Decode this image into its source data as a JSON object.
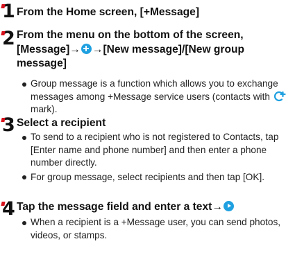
{
  "steps": [
    {
      "number": "1",
      "title": "From the Home screen, [+Message]"
    },
    {
      "number": "2",
      "title_part1": "From the menu on the bottom of the screen, [Message]",
      "arrow1": "→",
      "arrow2": "→",
      "title_part2": "[New message]/[New group message]",
      "bullet_text_before": "Group message is a function which allows you to exchange messages among +Message service users (contacts with ",
      "bullet_text_after": " mark)."
    },
    {
      "number": "3",
      "title": "Select a recipient",
      "bullets": [
        "To send to a recipient who is not registered to Contacts, tap [Enter name and phone number] and then enter a phone number directly.",
        "For group message, select recipients and then tap [OK]."
      ]
    },
    {
      "number": "4",
      "title_part1": "Tap the message field and enter a text",
      "arrow": "→",
      "bullets": [
        "When a recipient is a +Message user, you can send photos, videos, or stamps."
      ]
    }
  ],
  "icons": {
    "plus_button": "blue-circle-plus-icon",
    "send_button": "blue-circle-send-icon",
    "contact_mark": "plus-message-contact-icon"
  },
  "colors": {
    "step_accent": "#d6111b",
    "icon_blue": "#1fa0e0"
  }
}
